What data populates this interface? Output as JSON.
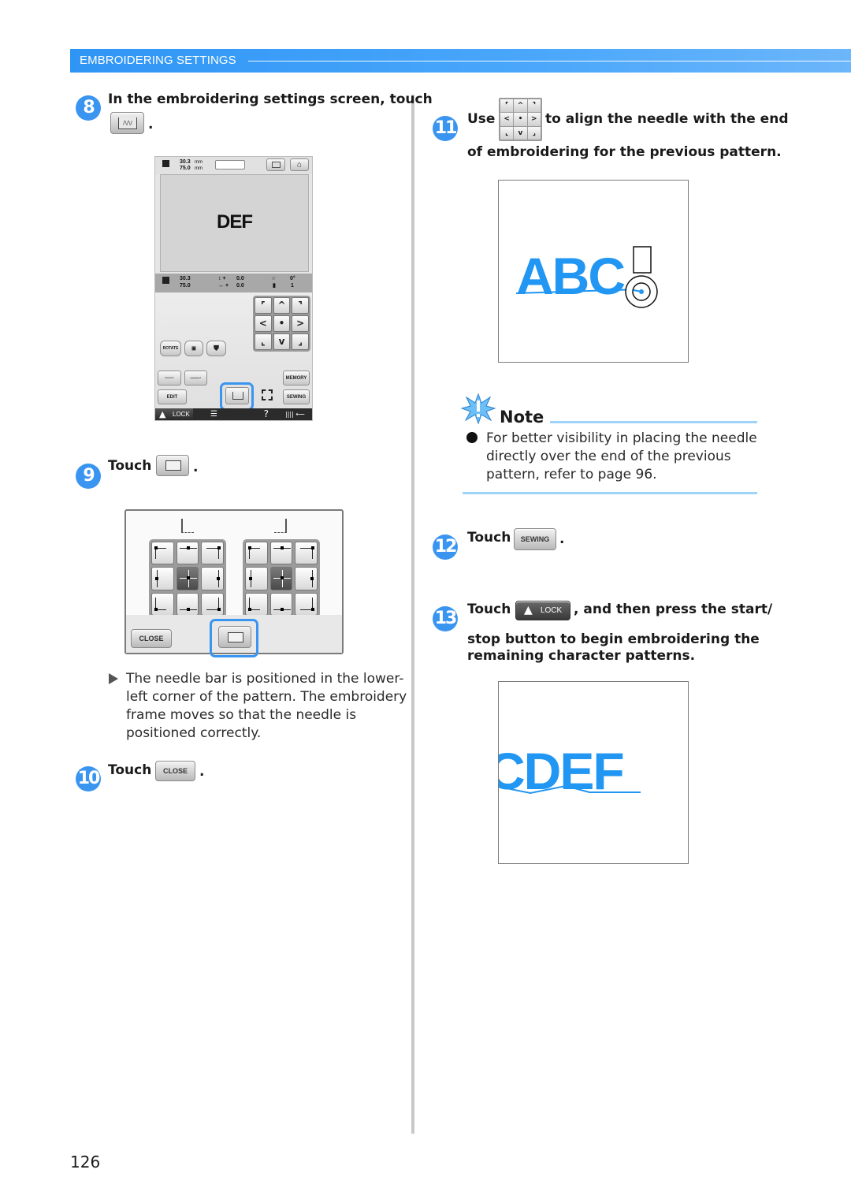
{
  "header": {
    "section_title": "EMBROIDERING SETTINGS"
  },
  "colors": {
    "accent": "#3a95f0",
    "header_bar": "#2f95f5",
    "note_rule": "#9fd3f9",
    "pattern_blue": "#2196f3"
  },
  "left_column": {
    "step8": {
      "number": "8",
      "text": "In the embroidering settings screen, touch",
      "button_icon": "start-point-setting-icon",
      "trailing": "."
    },
    "screen": {
      "size_w": "30.3",
      "size_h": "75.0",
      "unit": "mm",
      "pattern_text": "DEF",
      "info": {
        "size_w": "30.3",
        "size_h": "75.0",
        "offset_v": "0.0",
        "offset_h": "0.0",
        "unit": "mm",
        "rotation": "0°",
        "color_count": "1"
      },
      "arrow_keys": [
        "⌜",
        "^",
        "⌝",
        "<",
        "•",
        ">",
        "⌞",
        "v",
        "⌟"
      ],
      "buttons": {
        "rotate": "ROTATE",
        "memory": "MEMORY",
        "edit": "EDIT",
        "sewing": "SEWING",
        "lock": "LOCK",
        "help": "?"
      }
    },
    "step9": {
      "number": "9",
      "text": "Touch",
      "button_icon": "needle-start-point-icon",
      "trailing": "."
    },
    "dialog": {
      "close_label": "CLOSE"
    },
    "result_text": "The needle bar is positioned in the lower-left corner of the pattern. The embroidery frame moves so that the needle is positioned correctly.",
    "result_lines": [
      "The needle bar is positioned in the lower-",
      "left corner of the pattern. The embroidery",
      "frame moves so that the needle is",
      "positioned correctly."
    ],
    "step10": {
      "number": "10",
      "text": "Touch",
      "button_label": "CLOSE",
      "trailing": "."
    }
  },
  "right_column": {
    "step11": {
      "number": "11",
      "text_before": "Use",
      "text_after": "to align the needle with the end",
      "text_line2": "of embroidering for the previous pattern.",
      "arrow_keys": [
        "⌜",
        "^",
        "⌝",
        "<",
        "•",
        ">",
        "⌞",
        "v",
        "⌟"
      ]
    },
    "illustration1_text": "ABC",
    "note": {
      "title": "Note",
      "lines": [
        "For better visibility in placing the needle",
        "directly over the end of the previous",
        "pattern, refer to page 96."
      ]
    },
    "step12": {
      "number": "12",
      "text": "Touch",
      "button_label": "SEWING",
      "trailing": "."
    },
    "step13": {
      "number": "13",
      "text": "Touch",
      "button_label": "LOCK",
      "text_after": ", and then press the start/",
      "text_line2": "stop button to begin embroidering the",
      "text_line3": "remaining character patterns."
    },
    "illustration2_text": "CDEF"
  },
  "page_number": "126"
}
